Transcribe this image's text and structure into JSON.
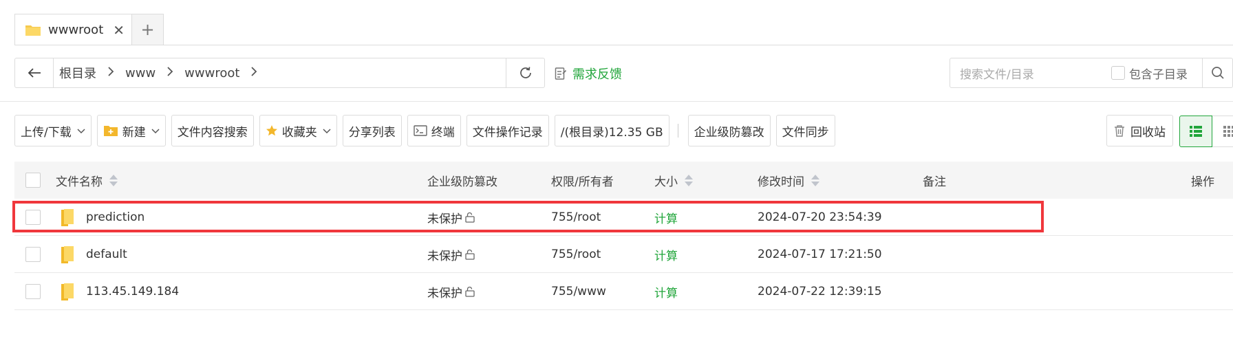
{
  "tab": {
    "label": "wwwroot",
    "close": "✕",
    "add": "+"
  },
  "path": {
    "crumbs": [
      "根目录",
      "www",
      "wwwroot"
    ],
    "sep": "›"
  },
  "feedback": "需求反馈",
  "search": {
    "placeholder": "搜索文件/目录",
    "include_sub": "包含子目录"
  },
  "toolbar": {
    "upload": "上传/下载",
    "new": "新建",
    "content_search": "文件内容搜索",
    "favorites": "收藏夹",
    "share_list": "分享列表",
    "terminal": "终端",
    "op_log": "文件操作记录",
    "disk": "/(根目录)12.35 GB",
    "tamper": "企业级防篡改",
    "sync": "文件同步",
    "recycle": "回收站"
  },
  "table": {
    "headers": {
      "name": "文件名称",
      "tamper": "企业级防篡改",
      "perm": "权限/所有者",
      "size": "大小",
      "mtime": "修改时间",
      "note": "备注",
      "ops": "操作"
    },
    "rows": [
      {
        "name": "prediction",
        "tamper": "未保护",
        "perm": "755/root",
        "size": "计算",
        "mtime": "2024-07-20 23:54:39",
        "highlighted": true
      },
      {
        "name": "default",
        "tamper": "未保护",
        "perm": "755/root",
        "size": "计算",
        "mtime": "2024-07-17 17:21:50"
      },
      {
        "name": "113.45.149.184",
        "tamper": "未保护",
        "perm": "755/www",
        "size": "计算",
        "mtime": "2024-07-22 12:39:15"
      }
    ]
  },
  "colors": {
    "accent": "#20a53a",
    "highlight": "#f0373c",
    "folder": "#f6c94e"
  }
}
